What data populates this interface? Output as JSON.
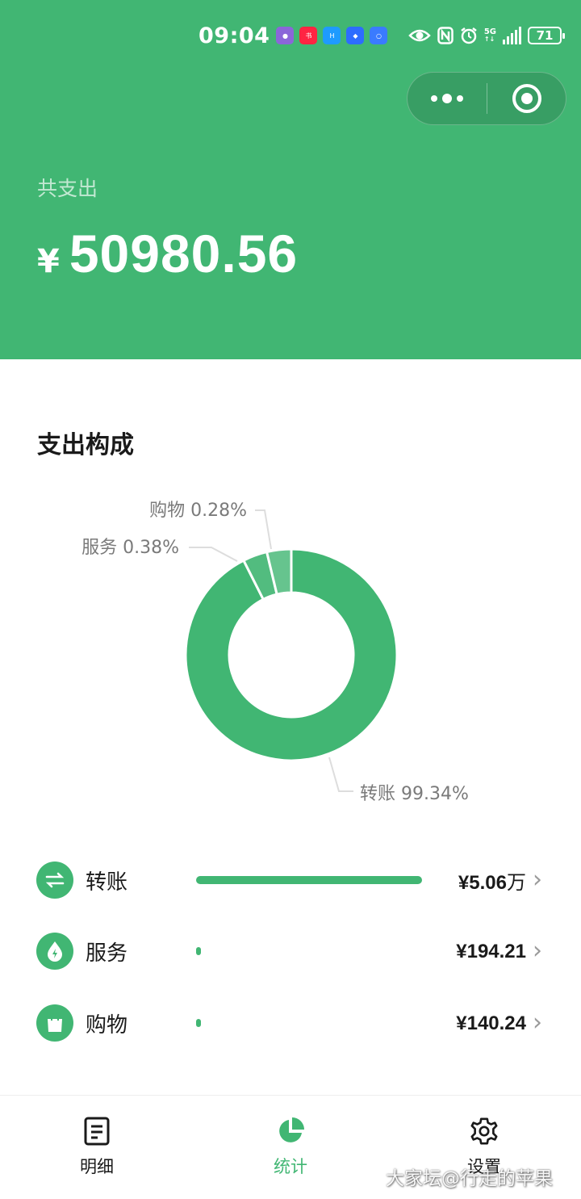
{
  "status_bar": {
    "time": "09:04",
    "network": "5G",
    "battery": "71",
    "app_icons": [
      "bilibili-icon",
      "xiaohongshu-icon",
      "xianyu-icon",
      "baidu-icon",
      "qq-browser-icon"
    ],
    "system_icons": [
      "eye-icon",
      "nfc-icon",
      "alarm-icon",
      "signal-icon",
      "battery-icon"
    ]
  },
  "capsule": {
    "more_icon": "more-dots-icon",
    "close_icon": "target-circle-icon"
  },
  "summary": {
    "label": "共支出",
    "currency": "¥",
    "amount": "50980.56"
  },
  "composition": {
    "title": "支出构成"
  },
  "chart_data": {
    "type": "pie",
    "title": "支出构成",
    "donut": true,
    "slices": [
      {
        "label": "转账",
        "percent_label": "99.34%",
        "value": 99.34,
        "color": "#41b673"
      },
      {
        "label": "服务",
        "percent_label": "0.38%",
        "value": 0.38,
        "color": "#52bc7f"
      },
      {
        "label": "购物",
        "percent_label": "0.28%",
        "value": 0.28,
        "color": "#66c48e"
      }
    ]
  },
  "categories": [
    {
      "name": "转账",
      "icon": "transfer-arrows-icon",
      "amount_prefix": "¥",
      "amount_number": "5.06",
      "amount_unit": "万",
      "fill_fraction": 1.0
    },
    {
      "name": "服务",
      "icon": "service-drop-icon",
      "amount_prefix": "¥",
      "amount_number": "194.21",
      "amount_unit": "",
      "fill_fraction": 0.004
    },
    {
      "name": "购物",
      "icon": "shopping-bag-icon",
      "amount_prefix": "¥",
      "amount_number": "140.24",
      "amount_unit": "",
      "fill_fraction": 0.003
    }
  ],
  "tabbar": {
    "tabs": [
      {
        "label": "明细",
        "icon": "document-icon",
        "active": false
      },
      {
        "label": "统计",
        "icon": "pie-chart-icon",
        "active": true
      },
      {
        "label": "设置",
        "icon": "gear-icon",
        "active": false
      }
    ]
  },
  "watermark": {
    "text": "大家坛@行走的苹果"
  },
  "colors": {
    "primary": "#41b673",
    "text": "#1a1a1a",
    "muted": "#7a7a7a"
  }
}
